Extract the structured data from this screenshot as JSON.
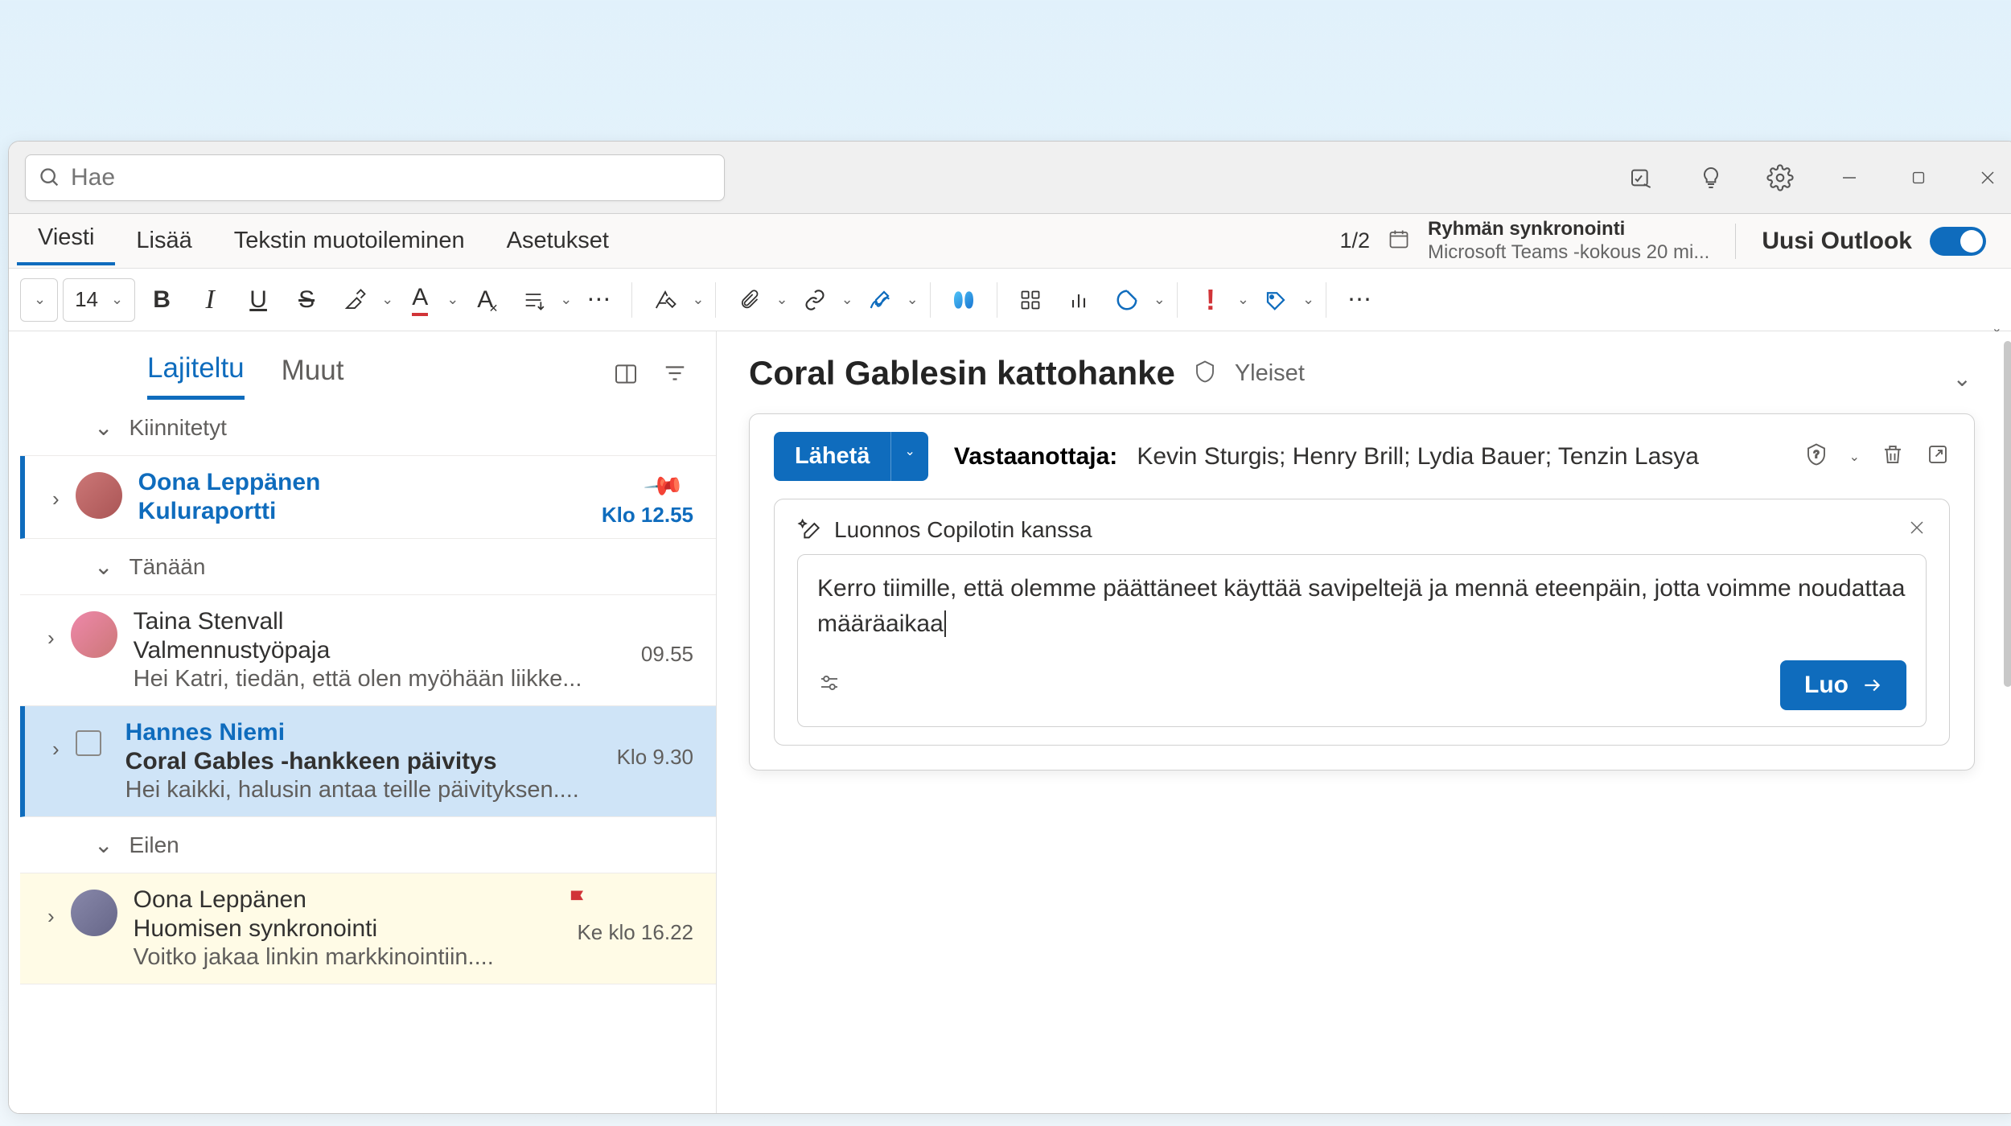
{
  "search": {
    "placeholder": "Hae"
  },
  "menubar": {
    "tabs": [
      "Viesti",
      "Lisää",
      "Tekstin muotoileminen",
      "Asetukset"
    ],
    "counter": "1/2",
    "sync": {
      "title": "Ryhmän synkronointi",
      "detail": "Microsoft Teams -kokous 20 mi..."
    },
    "toggle_label": "Uusi Outlook"
  },
  "toolbar": {
    "font_size": "14"
  },
  "list": {
    "tabs": {
      "sorted": "Lajiteltu",
      "other": "Muut"
    },
    "sections": {
      "pinned": "Kiinnitetyt",
      "today": "Tänään",
      "yesterday": "Eilen"
    },
    "messages": [
      {
        "from": "Oona Leppänen",
        "subject": "Kuluraportti",
        "time": "Klo 12.55"
      },
      {
        "from": "Taina Stenvall",
        "subject": "Valmennustyöpaja",
        "preview": "Hei Katri, tiedän, että olen myöhään liikke...",
        "time": "09.55"
      },
      {
        "from": "Hannes Niemi",
        "subject": "Coral Gables -hankkeen päivitys",
        "preview": "Hei kaikki, halusin antaa teille päivityksen....",
        "time": "Klo 9.30"
      },
      {
        "from": "Oona Leppänen",
        "subject": "Huomisen synkronointi",
        "preview": "Voitko jakaa linkin markkinointiin....",
        "time": "Ke klo 16.22"
      }
    ]
  },
  "reader": {
    "subject": "Coral Gablesin kattohanke",
    "category": "Yleiset",
    "send": "Lähetä",
    "to_label": "Vastaanottaja:",
    "to_names": "Kevin Sturgis; Henry Brill; Lydia Bauer; Tenzin Lasya",
    "copilot": {
      "title": "Luonnos Copilotin kanssa",
      "prompt": "Kerro tiimille, että olemme päättäneet käyttää savipeltejä ja mennä eteenpäin, jotta voimme noudattaa määräaikaa",
      "create": "Luo"
    }
  },
  "colors": {
    "accent": "#0f6cbd"
  }
}
